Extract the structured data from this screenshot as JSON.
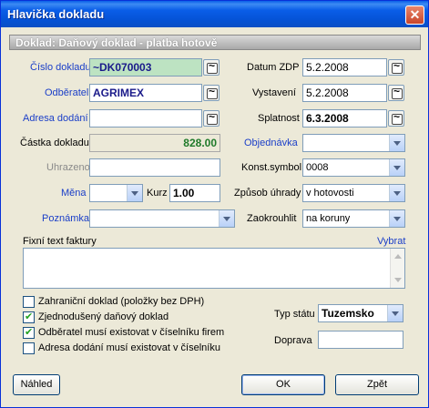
{
  "window": {
    "title": "Hlavička dokladu"
  },
  "header_bar": {
    "text": "Doklad: Daňový doklad - platba hotově"
  },
  "left": {
    "cislo_label": "Číslo dokladu",
    "cislo_value": "~DK070003",
    "odberatel_label": "Odběratel",
    "odberatel_value": "AGRIMEX",
    "adresa_label": "Adresa dodání",
    "adresa_value": "",
    "castka_label": "Částka dokladu",
    "castka_value": "828.00",
    "uhrazeno_label": "Uhrazeno",
    "uhrazeno_value": "",
    "mena_label": "Měna",
    "mena_value": "",
    "kurz_label": "Kurz",
    "kurz_value": "1.00",
    "poznamka_label": "Poznámka",
    "poznamka_value": ""
  },
  "right": {
    "datum_zdp_label": "Datum ZDP",
    "datum_zdp_value": "5.2.2008",
    "vystaveni_label": "Vystavení",
    "vystaveni_value": "5.2.2008",
    "splatnost_label": "Splatnost",
    "splatnost_value": "6.3.2008",
    "objednavka_label": "Objednávka",
    "objednavka_value": "",
    "konst_label": "Konst.symbol",
    "konst_value": "0008",
    "zpusob_label": "Způsob úhrady",
    "zpusob_value": "v hotovosti",
    "zaokrouhlit_label": "Zaokrouhlit",
    "zaokrouhlit_value": "na koruny"
  },
  "memo": {
    "label": "Fixní text faktury",
    "vybrat_link": "Vybrat",
    "value": ""
  },
  "checkboxes": [
    {
      "label": "Zahraniční doklad (položky bez DPH)",
      "checked": false
    },
    {
      "label": "Zjednodušený daňový doklad",
      "checked": true
    },
    {
      "label": "Odběratel musí existovat v číselníku firem",
      "checked": true
    },
    {
      "label": "Adresa dodání musí existovat v číselníku",
      "checked": false
    }
  ],
  "typ_statu": {
    "label": "Typ státu",
    "value": "Tuzemsko"
  },
  "doprava": {
    "label": "Doprava",
    "value": ""
  },
  "buttons": {
    "nahled": "Náhled",
    "ok": "OK",
    "zpet": "Zpět"
  }
}
